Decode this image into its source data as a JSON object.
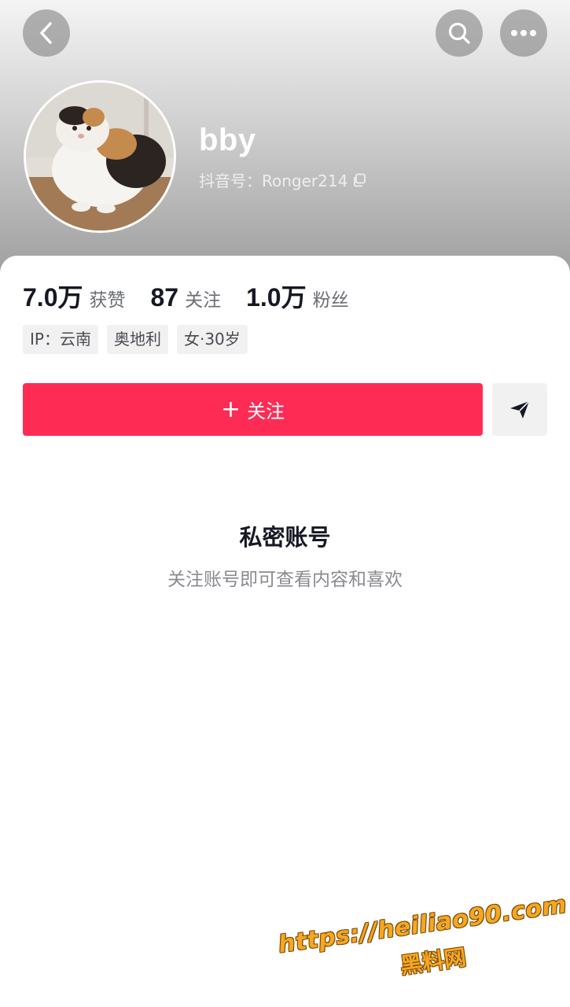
{
  "profile": {
    "username": "bby",
    "douyin_id": "抖音号：Ronger214",
    "avatar_alt": "calico cat photo"
  },
  "stats": [
    {
      "value": "7.0万",
      "label": "获赞"
    },
    {
      "value": "87",
      "label": "关注"
    },
    {
      "value": "1.0万",
      "label": "粉丝"
    }
  ],
  "tags": [
    "IP：云南",
    "奥地利",
    "女·30岁"
  ],
  "actions": {
    "follow_label": "关注",
    "follow_plus": "+"
  },
  "private": {
    "title": "私密账号",
    "subtitle": "关注账号即可查看内容和喜欢"
  },
  "watermark": {
    "url": "https://heiliao90.com",
    "name": "黑料网"
  },
  "colors": {
    "accent": "#fe2c55",
    "text_primary": "#161823",
    "text_secondary": "#8a8b91",
    "tag_bg": "#f1f1f2",
    "watermark": "#f5a623"
  },
  "icons": {
    "back": "chevron-left-icon",
    "search": "search-icon",
    "more": "more-dots-icon",
    "copy": "copy-icon",
    "share": "send-icon"
  }
}
